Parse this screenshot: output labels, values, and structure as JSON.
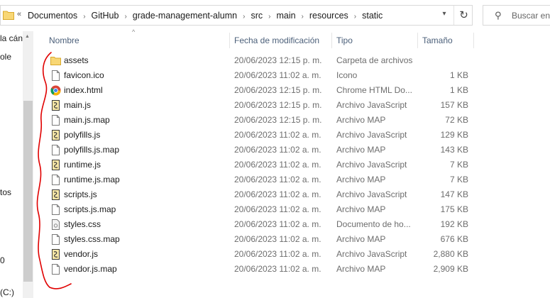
{
  "address_bar": {
    "overflow_label": "«",
    "crumbs": [
      "Documentos",
      "GitHub",
      "grade-management-alumn",
      "src",
      "main",
      "resources",
      "static"
    ],
    "separator": "›",
    "refresh_glyph": "↻"
  },
  "search": {
    "placeholder": "Buscar en"
  },
  "nav": {
    "items": [
      "la cán",
      "ole",
      "tos",
      "0",
      "(C:)"
    ]
  },
  "columns": {
    "name": "Nombre",
    "modified": "Fecha de modificación",
    "type": "Tipo",
    "size": "Tamaño"
  },
  "files": [
    {
      "name": "assets",
      "modified": "20/06/2023 12:15 p. m.",
      "type": "Carpeta de archivos",
      "size": "",
      "icon": "folder-icon"
    },
    {
      "name": "favicon.ico",
      "modified": "20/06/2023 11:02 a. m.",
      "type": "Icono",
      "size": "1 KB",
      "icon": "file-icon"
    },
    {
      "name": "index.html",
      "modified": "20/06/2023 12:15 p. m.",
      "type": "Chrome HTML Do...",
      "size": "1 KB",
      "icon": "chrome-icon"
    },
    {
      "name": "main.js",
      "modified": "20/06/2023 12:15 p. m.",
      "type": "Archivo JavaScript",
      "size": "157 KB",
      "icon": "js-file-icon"
    },
    {
      "name": "main.js.map",
      "modified": "20/06/2023 12:15 p. m.",
      "type": "Archivo MAP",
      "size": "72 KB",
      "icon": "file-icon"
    },
    {
      "name": "polyfills.js",
      "modified": "20/06/2023 11:02 a. m.",
      "type": "Archivo JavaScript",
      "size": "129 KB",
      "icon": "js-file-icon"
    },
    {
      "name": "polyfills.js.map",
      "modified": "20/06/2023 11:02 a. m.",
      "type": "Archivo MAP",
      "size": "143 KB",
      "icon": "file-icon"
    },
    {
      "name": "runtime.js",
      "modified": "20/06/2023 11:02 a. m.",
      "type": "Archivo JavaScript",
      "size": "7 KB",
      "icon": "js-file-icon"
    },
    {
      "name": "runtime.js.map",
      "modified": "20/06/2023 11:02 a. m.",
      "type": "Archivo MAP",
      "size": "7 KB",
      "icon": "file-icon"
    },
    {
      "name": "scripts.js",
      "modified": "20/06/2023 11:02 a. m.",
      "type": "Archivo JavaScript",
      "size": "147 KB",
      "icon": "js-file-icon"
    },
    {
      "name": "scripts.js.map",
      "modified": "20/06/2023 11:02 a. m.",
      "type": "Archivo MAP",
      "size": "175 KB",
      "icon": "file-icon"
    },
    {
      "name": "styles.css",
      "modified": "20/06/2023 11:02 a. m.",
      "type": "Documento de ho...",
      "size": "192 KB",
      "icon": "css-file-icon"
    },
    {
      "name": "styles.css.map",
      "modified": "20/06/2023 11:02 a. m.",
      "type": "Archivo MAP",
      "size": "676 KB",
      "icon": "file-icon"
    },
    {
      "name": "vendor.js",
      "modified": "20/06/2023 11:02 a. m.",
      "type": "Archivo JavaScript",
      "size": "2,880 KB",
      "icon": "js-file-icon"
    },
    {
      "name": "vendor.js.map",
      "modified": "20/06/2023 11:02 a. m.",
      "type": "Archivo MAP",
      "size": "2,909 KB",
      "icon": "file-icon"
    }
  ],
  "colors": {
    "folder": "#f8d775",
    "header_text": "#4c607a",
    "annotation": "#e00000"
  }
}
